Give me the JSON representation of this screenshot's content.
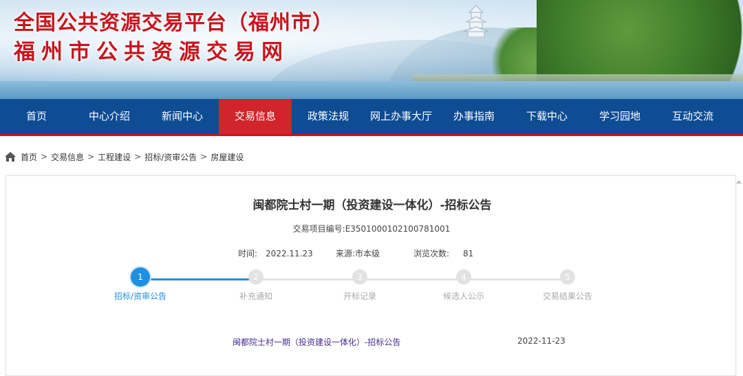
{
  "banner": {
    "title_line1": "全国公共资源交易平台（福州市）",
    "title_line2": "福州市公共资源交易网",
    "title_color": "#c8141e"
  },
  "nav": {
    "items": [
      {
        "label": "首页"
      },
      {
        "label": "中心介绍"
      },
      {
        "label": "新闻中心"
      },
      {
        "label": "交易信息",
        "active": true
      },
      {
        "label": "政策法规"
      },
      {
        "label": "网上办事大厅"
      },
      {
        "label": "办事指南"
      },
      {
        "label": "下载中心"
      },
      {
        "label": "学习园地"
      },
      {
        "label": "互动交流"
      }
    ],
    "bg_color": "#0e4c94",
    "active_color": "#d1242b"
  },
  "breadcrumb": {
    "icon": "home-icon",
    "items": [
      "首页",
      "交易信息",
      "工程建设",
      "招标/资审公告",
      "房屋建设"
    ],
    "separator": ">"
  },
  "article": {
    "title": "闽都院士村一期（投资建设一体化）-招标公告",
    "project_code": "交易项目编号:E3501000102100781001",
    "time_label": "时间:",
    "time_value": "2022.11.23",
    "source_label": "来源:",
    "source_value": "市本级",
    "views_label": "浏览次数:",
    "views_value": "81"
  },
  "steps": {
    "accent_color": "#1e8fe1",
    "current": 1,
    "items": [
      {
        "number": "1",
        "label": "招标/资审公告"
      },
      {
        "number": "2",
        "label": "补充通知"
      },
      {
        "number": "3",
        "label": "开标记录"
      },
      {
        "number": "4",
        "label": "候选人公示"
      },
      {
        "number": "5",
        "label": "交易结果公告"
      }
    ]
  },
  "listing": {
    "items": [
      {
        "title": "闽都院士村一期（投资建设一体化）-招标公告",
        "date": "2022-11-23"
      }
    ]
  }
}
